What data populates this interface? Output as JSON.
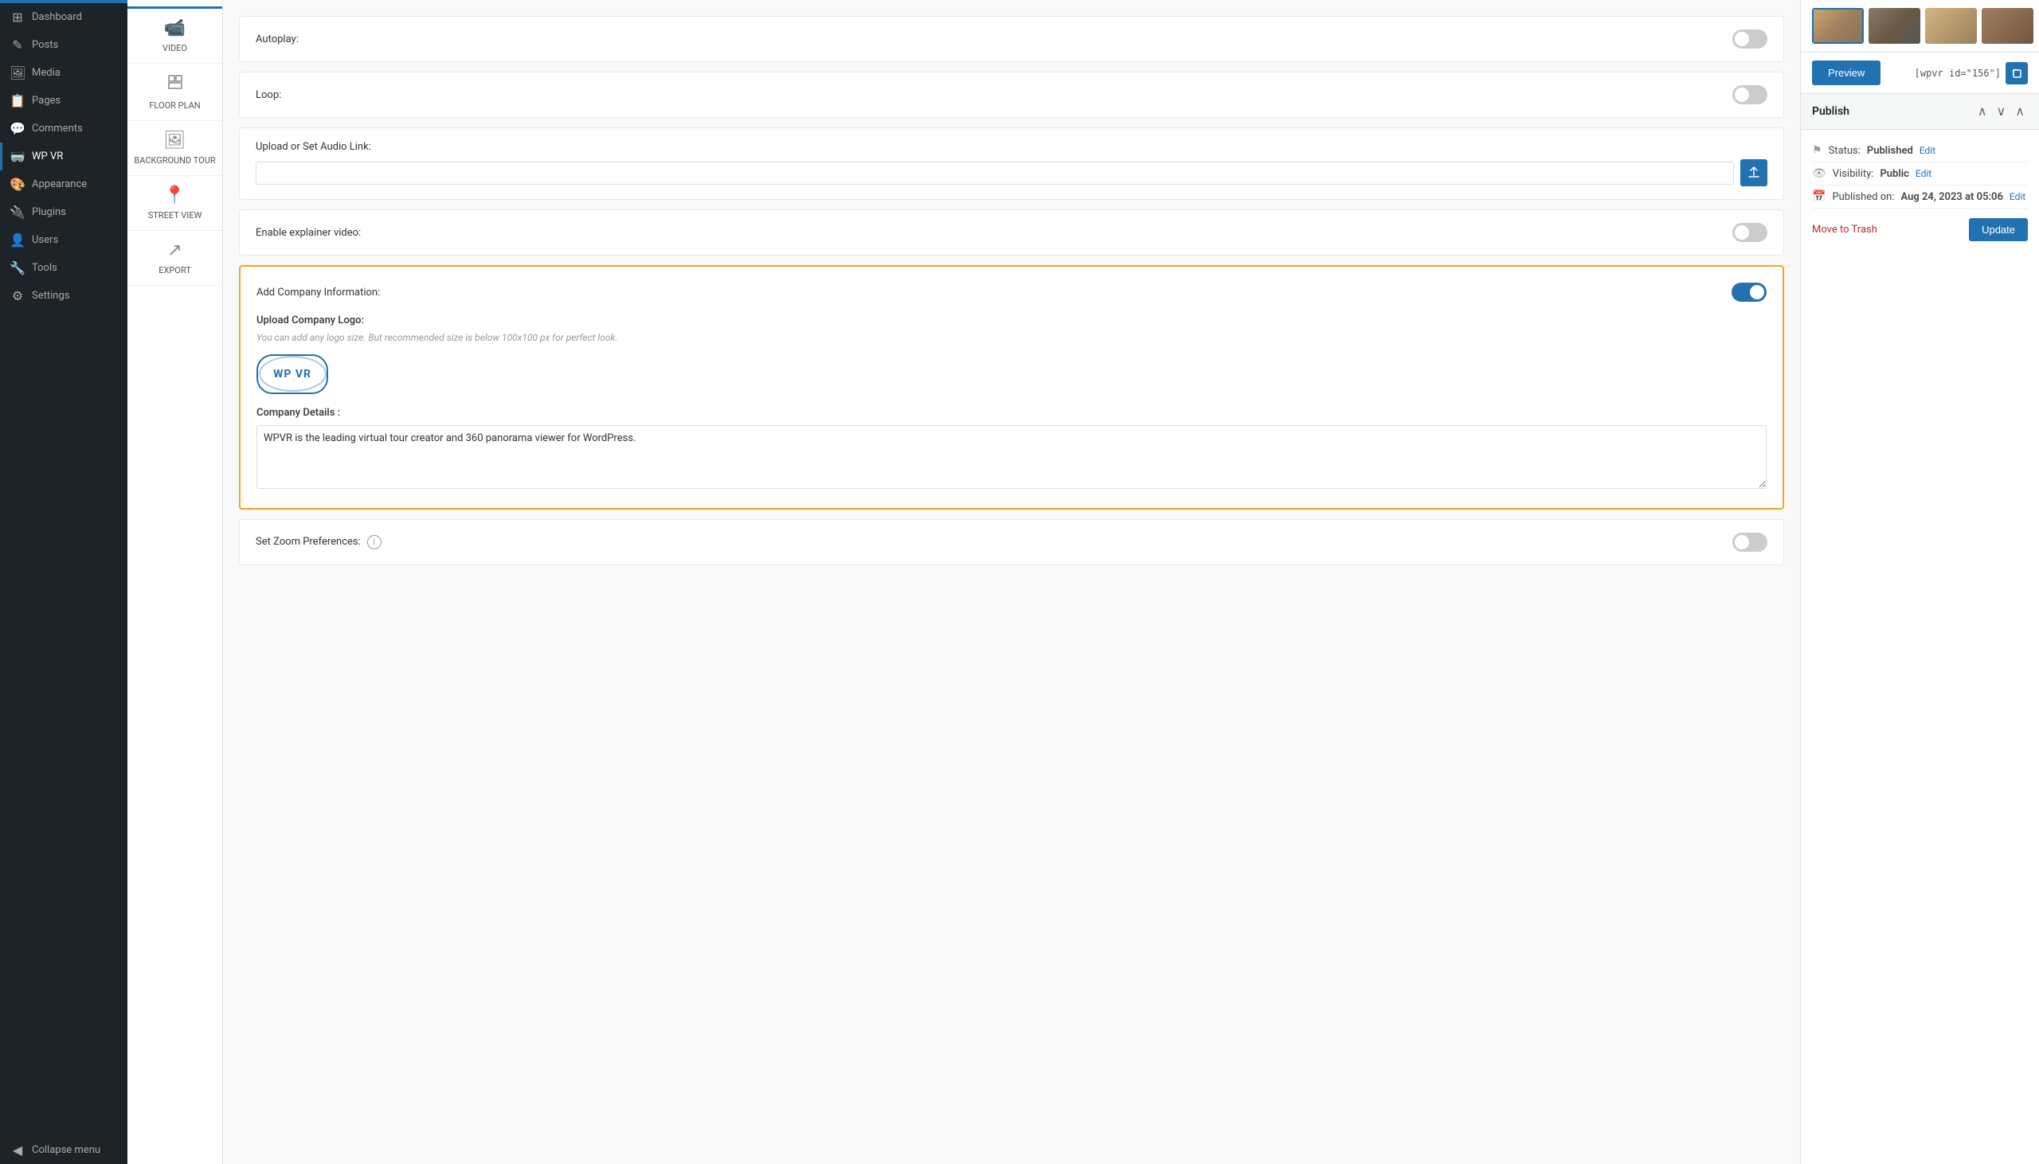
{
  "sidebar": {
    "items": [
      {
        "id": "dashboard",
        "label": "Dashboard",
        "icon": "⊞"
      },
      {
        "id": "posts",
        "label": "Posts",
        "icon": "📄"
      },
      {
        "id": "media",
        "label": "Media",
        "icon": "🖼"
      },
      {
        "id": "pages",
        "label": "Pages",
        "icon": "📋"
      },
      {
        "id": "comments",
        "label": "Comments",
        "icon": "💬"
      },
      {
        "id": "wp-vr",
        "label": "WP VR",
        "icon": "🥽",
        "active": true
      },
      {
        "id": "appearance",
        "label": "Appearance",
        "icon": "🎨"
      },
      {
        "id": "plugins",
        "label": "Plugins",
        "icon": "🔌"
      },
      {
        "id": "users",
        "label": "Users",
        "icon": "👤"
      },
      {
        "id": "tools",
        "label": "Tools",
        "icon": "🔧"
      },
      {
        "id": "settings",
        "label": "Settings",
        "icon": "⚙"
      },
      {
        "id": "collapse",
        "label": "Collapse menu",
        "icon": "◀"
      }
    ]
  },
  "icon_panel": {
    "items": [
      {
        "id": "video",
        "label": "VIDEO",
        "icon": "📹"
      },
      {
        "id": "floor-plan",
        "label": "FLOOR PLAN",
        "icon": "📐"
      },
      {
        "id": "background-tour",
        "label": "BACKGROUND TOUR",
        "icon": "🖼"
      },
      {
        "id": "street-view",
        "label": "STREET VIEW",
        "icon": "📍"
      },
      {
        "id": "export",
        "label": "EXPORT",
        "icon": "↗"
      }
    ]
  },
  "settings": {
    "autoplay_label": "Autoplay:",
    "loop_label": "Loop:",
    "audio_link_label": "Upload or Set Audio Link:",
    "audio_placeholder": "",
    "explainer_video_label": "Enable explainer video:",
    "add_company_label": "Add Company Information:",
    "company_info_enabled": true,
    "upload_logo_label": "Upload Company Logo:",
    "logo_hint": "You can add any logo size. But recommended size is below 100x100 px for perfect look.",
    "logo_text": "WP VR",
    "company_details_label": "Company Details :",
    "company_details_value": "WPVR is the leading virtual tour creator and 360 panorama viewer for WordPress.",
    "zoom_label": "Set Zoom Preferences:"
  },
  "publish": {
    "title": "Publish",
    "status_label": "Status:",
    "status_value": "Published",
    "status_edit": "Edit",
    "visibility_label": "Visibility:",
    "visibility_value": "Public",
    "visibility_edit": "Edit",
    "published_label": "Published on:",
    "published_value": "Aug 24, 2023 at 05:06",
    "published_edit": "Edit",
    "move_to_trash": "Move to Trash",
    "update_label": "Update"
  },
  "preview": {
    "button_label": "Preview",
    "shortcode": "[wpvr id=\"156\"]",
    "copy_icon": "⧉"
  },
  "colors": {
    "accent_blue": "#2271b1",
    "orange_border": "#f5a623",
    "sidebar_bg": "#1d2327"
  }
}
